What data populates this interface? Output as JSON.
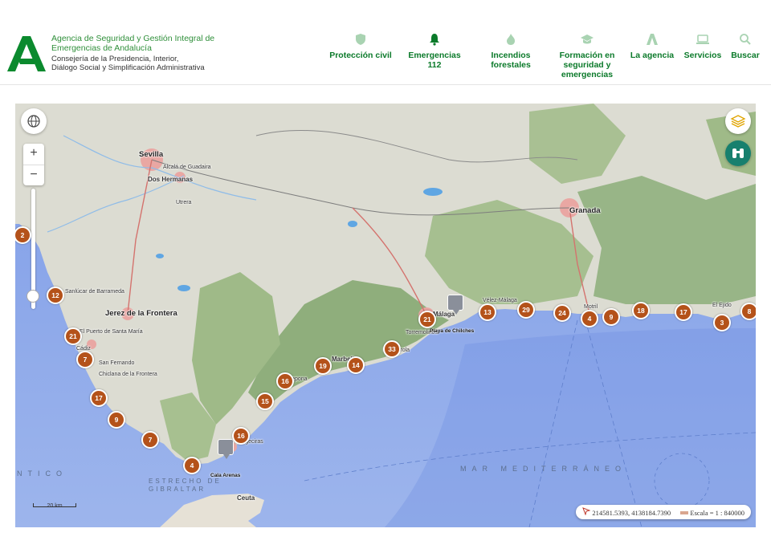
{
  "header": {
    "org_line1": "Agencia de Seguridad y Gestión Integral de",
    "org_line2": "Emergencias de Andalucía",
    "org_line3": "Consejería de la Presidencia, Interior,",
    "org_line4": "Diálogo Social y Simplificación Administrativa",
    "brand_color": "#2f8f3a"
  },
  "nav": [
    {
      "l1": "Protección civil",
      "l2": "",
      "l3": "",
      "icon": "shield-icon"
    },
    {
      "l1": "Emergencias",
      "l2": "112",
      "l3": "",
      "icon": "bell-icon"
    },
    {
      "l1": "Incendios",
      "l2": "forestales",
      "l3": "",
      "icon": "flame-icon"
    },
    {
      "l1": "Formación en",
      "l2": "seguridad y",
      "l3": "emergencias",
      "icon": "graduation-cap-icon"
    },
    {
      "l1": "La agencia",
      "l2": "",
      "l3": "",
      "icon": "agency-logo-icon"
    },
    {
      "l1": "Servicios",
      "l2": "",
      "l3": "",
      "icon": "laptop-icon"
    },
    {
      "l1": "Buscar",
      "l2": "",
      "l3": "",
      "icon": "search-icon"
    }
  ],
  "map": {
    "zoom_in": "+",
    "zoom_out": "−",
    "cluster_color": "#b4521a",
    "clusters": [
      "2",
      "12",
      "21",
      "7",
      "17",
      "9",
      "7",
      "4",
      "16",
      "15",
      "16",
      "19",
      "14",
      "33",
      "21",
      "13",
      "29",
      "24",
      "4",
      "9",
      "18",
      "17",
      "3",
      "8"
    ],
    "cities": {
      "sevilla": "Sevilla",
      "alcala": "Alcalá de Guadaira",
      "dos_hermanas": "Dos Hermanas",
      "utrera": "Utrera",
      "granada": "Granada",
      "sanlucar": "Sanlúcar de Barrameda",
      "jerez": "Jerez de la Frontera",
      "puerto": "El Puerto de Santa María",
      "cadiz": "Cádiz",
      "san_fernando": "San Fernando",
      "chiclana": "Chiclana de la Frontera",
      "velez": "Vélez-Málaga",
      "malaga": "Málaga",
      "torremolinos": "Torremolinos",
      "marbella": "Marbella",
      "estepona": "Estepona",
      "algeciras": "Algeciras",
      "ceuta": "Ceuta",
      "motril": "Motril",
      "ejido": "El Ejido",
      "fuengirola": "Fuengirola"
    },
    "sea_label": "MAR   MEDITERRÁNEO",
    "ocean_label": "NTICO",
    "strait_line1": "ESTRECHO DE",
    "strait_line2": "GIBRALTAR",
    "beaches": [
      "Playa de Chilches",
      "Cala Arenas"
    ],
    "scale_bar": "20 km",
    "coordinates": "214581.5393, 4138184.7390",
    "scale": "Escala = 1 : 840000"
  }
}
